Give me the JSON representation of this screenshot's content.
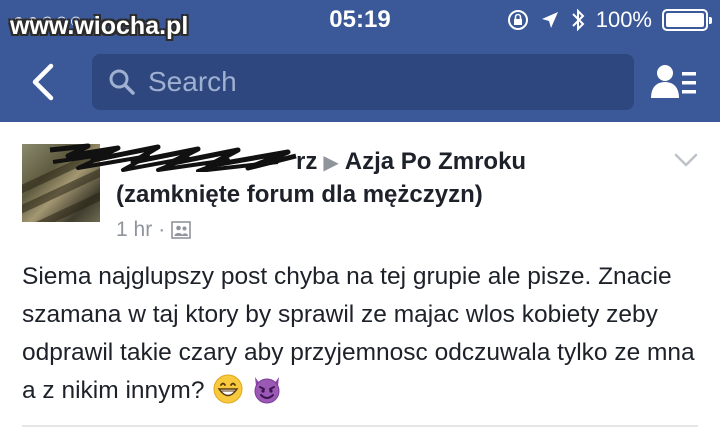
{
  "status_bar": {
    "carrier": "●●○○○ ",
    "watermark": "www.wiocha.pl",
    "time": "05:19",
    "battery_percent": "100%",
    "icons": [
      "wifi-icon",
      "rotation-lock-icon",
      "location-icon",
      "bluetooth-icon",
      "battery-icon"
    ]
  },
  "nav": {
    "back_icon": "chevron-left-icon",
    "search_placeholder": "Search",
    "friends_icon": "friends-list-icon"
  },
  "post": {
    "author_visible_tail": "rz",
    "group_line1": "Azja Po Zmroku",
    "group_line2": "(zamknięte forum dla mężczyzn)",
    "time": "1 hr",
    "separator": "·",
    "privacy_icon": "friends-privacy-icon",
    "menu_icon": "chevron-down-icon",
    "text": "Siema najglupszy post chyba na tej grupie ale pisze. Znacie szamana w taj ktory by sprawil ze majac wlos kobiety zeby odprawil takie czary aby przyjemnosc odczuwala tylko ze mna a z nikim innym?",
    "emojis": [
      "grinning-face-emoji",
      "smiling-devil-emoji"
    ]
  },
  "colors": {
    "header_bg": "#3b5998",
    "search_bg": "#2e477e",
    "text": "#1d2129",
    "meta": "#90949c"
  }
}
